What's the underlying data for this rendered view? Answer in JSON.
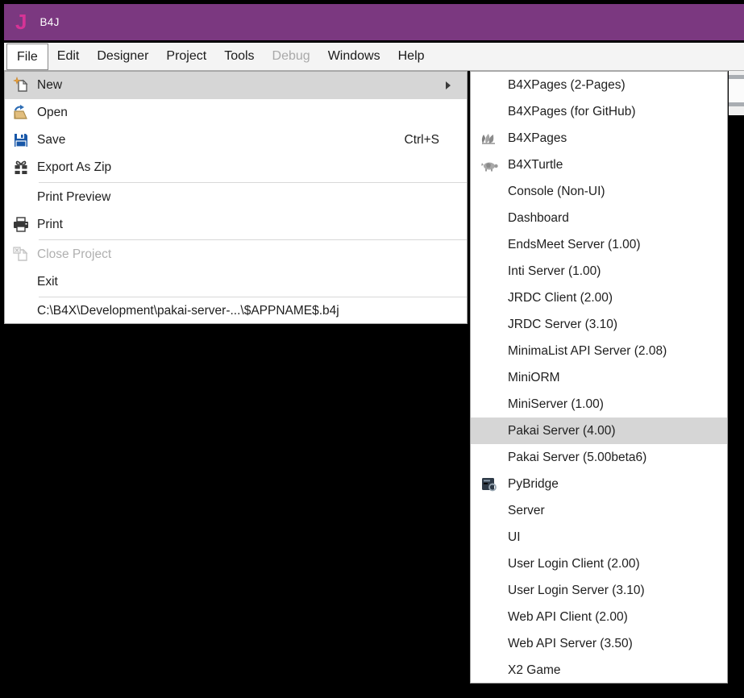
{
  "window": {
    "logo_letter": "J",
    "title": "B4J"
  },
  "colors": {
    "titlebar_purple": "#7B3880",
    "logo_pink": "#D63396",
    "menu_highlight": "#D6D6D6",
    "save_blue": "#1857A8",
    "folder_tan": "#E2BE7E",
    "star_orange": "#E8A33D"
  },
  "menubar": {
    "items": [
      {
        "id": "file",
        "label": "File",
        "open": true
      },
      {
        "id": "edit",
        "label": "Edit"
      },
      {
        "id": "designer",
        "label": "Designer"
      },
      {
        "id": "project",
        "label": "Project"
      },
      {
        "id": "tools",
        "label": "Tools"
      },
      {
        "id": "debug",
        "label": "Debug",
        "disabled": true
      },
      {
        "id": "windows",
        "label": "Windows"
      },
      {
        "id": "help",
        "label": "Help"
      }
    ]
  },
  "file_menu": {
    "items": [
      {
        "id": "new",
        "label": "New",
        "icon": "new-file",
        "has_submenu": true,
        "highlighted": true
      },
      {
        "id": "open",
        "label": "Open",
        "icon": "open-folder"
      },
      {
        "id": "save",
        "label": "Save",
        "icon": "save",
        "shortcut": "Ctrl+S"
      },
      {
        "id": "export-as-zip",
        "label": "Export As Zip",
        "icon": "export-zip"
      },
      {
        "separator": true
      },
      {
        "id": "print-preview",
        "label": "Print Preview"
      },
      {
        "id": "print",
        "label": "Print",
        "icon": "print"
      },
      {
        "separator": true
      },
      {
        "id": "close-project",
        "label": "Close Project",
        "icon": "close-project",
        "disabled": true
      },
      {
        "id": "exit",
        "label": "Exit"
      },
      {
        "separator": true
      },
      {
        "id": "recent-file",
        "label": "C:\\B4X\\Development\\pakai-server-...\\$APPNAME$.b4j",
        "recent": true
      }
    ]
  },
  "new_submenu": {
    "items": [
      {
        "id": "b4xpages-2-pages",
        "label": "B4XPages (2-Pages)"
      },
      {
        "id": "b4xpages-for-github",
        "label": "B4XPages (for GitHub)"
      },
      {
        "id": "b4xpages",
        "label": "B4XPages",
        "icon": "b4xpages"
      },
      {
        "id": "b4xturtle",
        "label": "B4XTurtle",
        "icon": "b4xturtle"
      },
      {
        "id": "console-non-ui",
        "label": "Console (Non-UI)"
      },
      {
        "id": "dashboard",
        "label": "Dashboard"
      },
      {
        "id": "endsmeet-server",
        "label": "EndsMeet Server (1.00)"
      },
      {
        "id": "inti-server",
        "label": "Inti Server (1.00)"
      },
      {
        "id": "jrdc-client",
        "label": "JRDC Client (2.00)"
      },
      {
        "id": "jrdc-server",
        "label": "JRDC Server (3.10)"
      },
      {
        "id": "minimalist-api-server",
        "label": "MinimaList API Server (2.08)"
      },
      {
        "id": "miniorm",
        "label": "MiniORM"
      },
      {
        "id": "miniserver",
        "label": "MiniServer (1.00)"
      },
      {
        "id": "pakai-server-4",
        "label": "Pakai Server (4.00)",
        "highlighted": true
      },
      {
        "id": "pakai-server-5-beta",
        "label": "Pakai Server (5.00beta6)"
      },
      {
        "id": "pybridge",
        "label": "PyBridge",
        "icon": "pybridge"
      },
      {
        "id": "server",
        "label": "Server"
      },
      {
        "id": "ui",
        "label": "UI"
      },
      {
        "id": "user-login-client",
        "label": "User Login Client (2.00)"
      },
      {
        "id": "user-login-server",
        "label": "User Login Server (3.10)"
      },
      {
        "id": "web-api-client",
        "label": "Web API Client (2.00)"
      },
      {
        "id": "web-api-server",
        "label": "Web API Server (3.50)"
      },
      {
        "id": "x2-game",
        "label": "X2 Game"
      }
    ]
  }
}
